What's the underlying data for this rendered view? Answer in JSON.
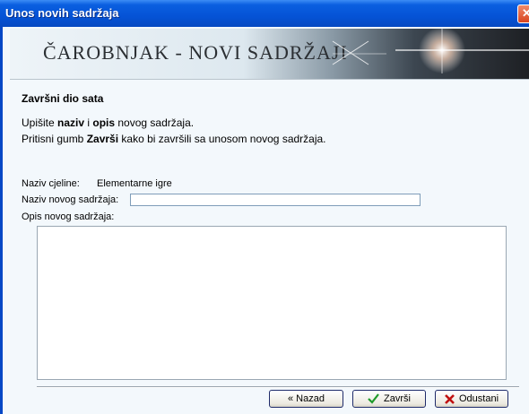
{
  "window": {
    "title": "Unos novih sadržaja",
    "close_glyph": "✕"
  },
  "banner": {
    "title": "ČAROBNJAK - NOVI SADRŽAJI"
  },
  "section": {
    "title": "Završni dio sata"
  },
  "instructions": {
    "line1": {
      "t1": "Upišite ",
      "b1": "naziv",
      "t2": " i ",
      "b2": "opis",
      "t3": " novog sadržaja."
    },
    "line2": {
      "t1": "Pritisni gumb ",
      "b1": "Završi",
      "t2": " kako bi završili sa unosom novog sadržaja."
    }
  },
  "form": {
    "unit_label": "Naziv cjeline:",
    "unit_value": "Elementarne igre",
    "name_label": "Naziv novog sadržaja:",
    "name_value": "",
    "desc_label": "Opis novog sadržaja:",
    "desc_value": ""
  },
  "buttons": {
    "back": "« Nazad",
    "finish": "Završi",
    "cancel": "Odustani"
  },
  "icons": {
    "finish": "check-icon",
    "cancel": "x-icon",
    "close": "close-icon"
  },
  "colors": {
    "titlebar": "#0553d6",
    "finish_check": "#1f9a2a",
    "cancel_x": "#c01010"
  }
}
